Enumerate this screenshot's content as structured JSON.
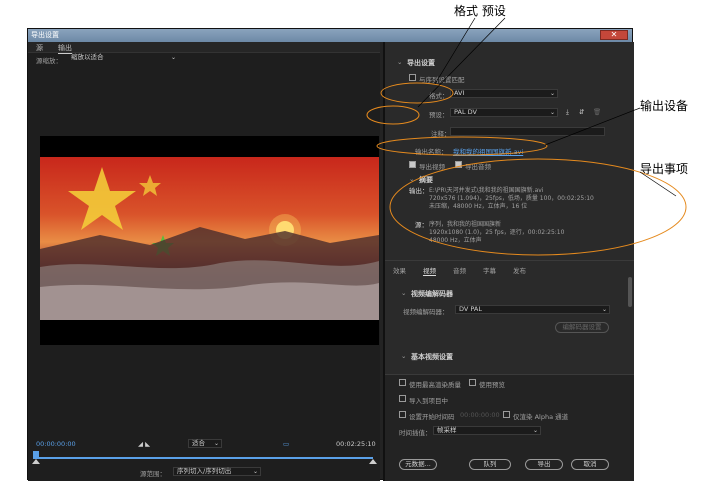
{
  "annotations": {
    "format_preset": "格式  预设",
    "output_device": "输出设备",
    "export_items": "导出事项"
  },
  "window": {
    "title": "导出设置",
    "close": "✕"
  },
  "left": {
    "tab_source": "源",
    "tab_output": "输出",
    "source_scaling_label": "源缩放：",
    "source_scaling_value": "缩放以适合",
    "timecode_start": "00:00:00:00",
    "fit_value": "适合",
    "timecode_end": "00:02:25:10",
    "source_range_label": "源范围：",
    "source_range_value": "序列切入/序列切出"
  },
  "right": {
    "export_settings": "导出设置",
    "match_sequence": "与序列设置匹配",
    "format_label": "格式：",
    "format_value": "AVI",
    "preset_label": "预设：",
    "preset_value": "PAL DV",
    "comment_label": "注释：",
    "output_name_label": "输出名称：",
    "output_name_value": "我和我的祖国国旗新.avi",
    "export_video": "导出视频",
    "export_audio": "导出音频",
    "summary_title": "摘要",
    "output_label": "输出：",
    "output_line1": "E:\\PR\\天河并发式\\我和我的祖国国旗新.avi",
    "output_line2": "720x576 (1.094)，25fps，低场，质量 100，00:02:25:10",
    "output_line3": "未压缩，48000 Hz，立体声，16 位",
    "source_label": "源：",
    "source_line1": "序列，我和我的祖国国旗新",
    "source_line2": "1920x1080 (1.0)，25 fps，逐行，00:02:25:10",
    "source_line3": "48000 Hz，立体声",
    "tabs": [
      "效果",
      "视频",
      "音频",
      "字幕",
      "发布"
    ],
    "codec_section": "视频编解码器",
    "codec_label": "视频编解码器：",
    "codec_value": "DV PAL",
    "codec_settings": "编解码器设置",
    "basic_video": "基本视频设置",
    "max_render": "使用最高渲染质量",
    "use_preview": "使用预览",
    "import_project": "导入到项目中",
    "set_start_tc": "设置开始时间码",
    "start_tc_value": "00:00:00:00",
    "alpha_only": "仅渲染 Alpha 通道",
    "interp_label": "时间插值：",
    "interp_value": "帧采样",
    "btn_metadata": "元数据...",
    "btn_queue": "队列",
    "btn_export": "导出",
    "btn_cancel": "取消"
  }
}
